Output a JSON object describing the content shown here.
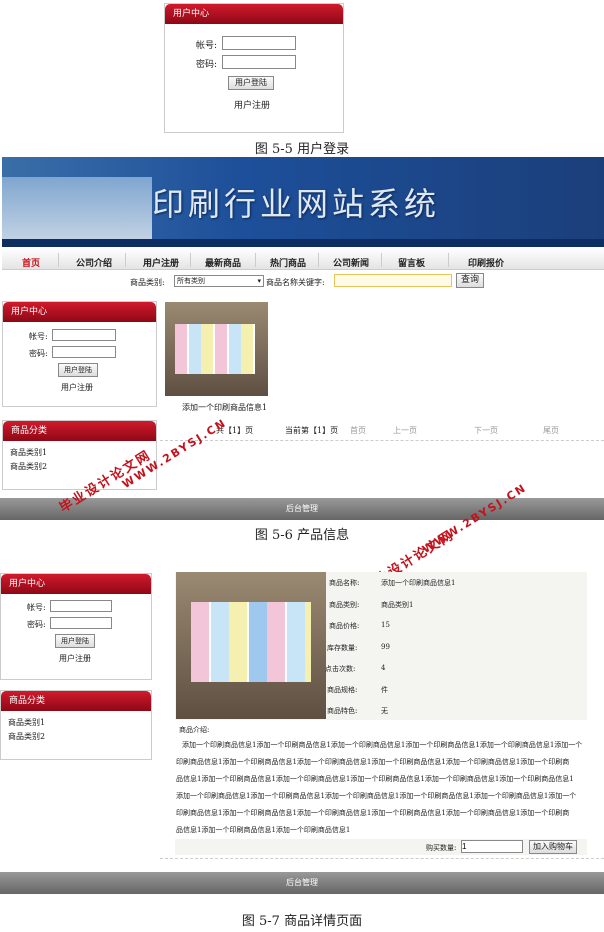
{
  "fig1": {
    "panel_title": "用户中心",
    "account_label": "帐号:",
    "password_label": "密码:",
    "login_button": "用户登陆",
    "register_link": "用户注册",
    "caption": "图 5-5 用户登录"
  },
  "fig2": {
    "banner_title": "印刷行业网站系统",
    "nav": [
      "首页",
      "公司介绍",
      "用户注册",
      "最新商品",
      "热门商品",
      "公司新闻",
      "留言板",
      "印刷报价"
    ],
    "search": {
      "category_label": "商品类别:",
      "category_value": "所有类别",
      "keyword_label": "商品名称关键字:",
      "keyword_value": "",
      "button": "查询"
    },
    "user_panel": {
      "title": "用户中心",
      "account_label": "帐号:",
      "password_label": "密码:",
      "login_button": "用户登陆",
      "register_link": "用户注册"
    },
    "category_panel": {
      "title": "商品分类",
      "items": [
        "商品类别1",
        "商品类别2"
      ]
    },
    "product_caption": "添加一个印刷商品信息1",
    "pager": {
      "total": "共【1】页",
      "current": "当前第【1】页",
      "first": "首页",
      "prev": "上一页",
      "next": "下一页",
      "last": "尾页"
    },
    "footer": "后台管理",
    "caption": "图 5-6 产品信息"
  },
  "fig3": {
    "user_panel": {
      "title": "用户中心",
      "account_label": "帐号:",
      "password_label": "密码:",
      "login_button": "用户登陆",
      "register_link": "用户注册"
    },
    "category_panel": {
      "title": "商品分类",
      "items": [
        "商品类别1",
        "商品类别2"
      ]
    },
    "details": [
      {
        "label": "商品名称:",
        "value": "添加一个印刷商品信息1"
      },
      {
        "label": "商品类别:",
        "value": "商品类别1"
      },
      {
        "label": "商品价格:",
        "value": "15"
      },
      {
        "label": "库存数量:",
        "value": "99"
      },
      {
        "label": "点击次数:",
        "value": "4"
      },
      {
        "label": "商品规格:",
        "value": "件"
      },
      {
        "label": "商品特色:",
        "value": "无"
      }
    ],
    "intro_label": "商品介绍:",
    "intro_lines": [
      "添加一个印刷商品信息1添加一个印刷商品信息1添加一个印刷商品信息1添加一个印刷商品信息1添加一个印刷商品信息1添加一个",
      "印刷商品信息1添加一个印刷商品信息1添加一个印刷商品信息1添加一个印刷商品信息1添加一个印刷商品信息1添加一个印刷商",
      "品信息1添加一个印刷商品信息1添加一个印刷商品信息1添加一个印刷商品信息1添加一个印刷商品信息1添加一个印刷商品信息1",
      "添加一个印刷商品信息1添加一个印刷商品信息1添加一个印刷商品信息1添加一个印刷商品信息1添加一个印刷商品信息1添加一个",
      "印刷商品信息1添加一个印刷商品信息1添加一个印刷商品信息1添加一个印刷商品信息1添加一个印刷商品信息1添加一个印刷商",
      "品信息1添加一个印刷商品信息1添加一个印刷商品信息1"
    ],
    "qty_label": "购买数量:",
    "qty_value": "1",
    "cart_button": "加入购物车",
    "footer": "后台管理",
    "caption": "图 5-7 商品详情页面"
  },
  "watermark": {
    "line1": "毕业设计论文网",
    "line2": "WWW.2BYSJ.CN"
  },
  "colors": {
    "accent_red": "#c4121c",
    "banner_blue": "#1d4f9a",
    "footer_grey": "#888888"
  }
}
